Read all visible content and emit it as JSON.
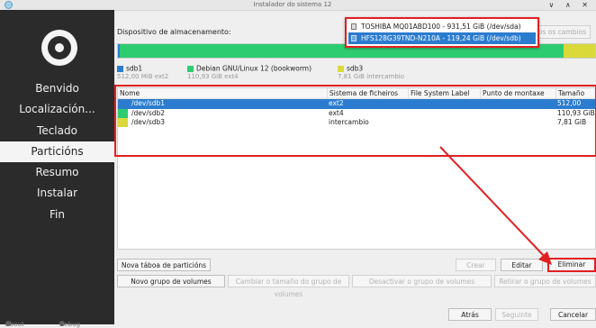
{
  "window": {
    "title": "Instalador do sistema 12",
    "controls": "∨ ∧ ✕"
  },
  "sidebar": {
    "items": [
      {
        "label": "Benvido"
      },
      {
        "label": "Localización..."
      },
      {
        "label": "Teclado"
      },
      {
        "label": "Particións"
      },
      {
        "label": "Resumo"
      },
      {
        "label": "Instalar"
      },
      {
        "label": "Fin"
      }
    ],
    "active_index": 3,
    "footer": {
      "about": "About",
      "debug": "Debug"
    }
  },
  "device": {
    "label": "Dispositivo de almacenamento:",
    "revert_label": "Reverter todos os cambios",
    "options": [
      {
        "label": "TOSHIBA MQ01ABD100 - 931,51 GiB (/dev/sda)",
        "selected": false
      },
      {
        "label": "HFS128G39TND-N210A - 119,24 GiB (/dev/sdb)",
        "selected": true
      }
    ]
  },
  "usage_bar": {
    "segments": [
      {
        "name": "sdb1",
        "fraction": 0.004,
        "color": "#2b7ccf"
      },
      {
        "name": "sdb2",
        "fraction": 0.93,
        "color": "#2ecc71"
      },
      {
        "name": "sdb3",
        "fraction": 0.066,
        "color": "#d9d93a"
      }
    ]
  },
  "legend": [
    {
      "name": "sdb1",
      "detail": "512,00 MiB  ext2",
      "color": "#2b7ccf"
    },
    {
      "name": "Debian GNU/Linux 12 (bookworm)",
      "detail": "110,93 GiB  ext4",
      "color": "#2ecc71"
    },
    {
      "name": "sdb3",
      "detail": "7,81 GiB  intercambio",
      "color": "#d9d93a"
    }
  ],
  "table": {
    "columns": [
      "Nome",
      "Sistema de ficheiros",
      "File System Label",
      "Punto de montaxe",
      "Tamaño"
    ],
    "rows": [
      {
        "name": "/dev/sdb1",
        "fs": "ext2",
        "label": "",
        "mount": "",
        "size": "512,00 MiB",
        "color": "#2b7ccf",
        "selected": true
      },
      {
        "name": "/dev/sdb2",
        "fs": "ext4",
        "label": "",
        "mount": "",
        "size": "110,93 GiB",
        "color": "#2ecc71",
        "selected": false
      },
      {
        "name": "/dev/sdb3",
        "fs": "intercambio",
        "label": "",
        "mount": "",
        "size": "7,81 GiB",
        "color": "#d9d93a",
        "selected": false
      }
    ]
  },
  "buttons": {
    "new_table": "Nova táboa de particións",
    "create": "Crear",
    "edit": "Editar",
    "delete": "Eliminar",
    "new_vg": "Novo grupo de volumes",
    "resize_vg": "Cambiar o tamaño do grupo de volumes",
    "deactivate_vg": "Desactivar o grupo de volumes",
    "remove_vg": "Retirar o grupo de volumes",
    "back": "Atrás",
    "next": "Seguinte",
    "cancel": "Cancelar"
  }
}
